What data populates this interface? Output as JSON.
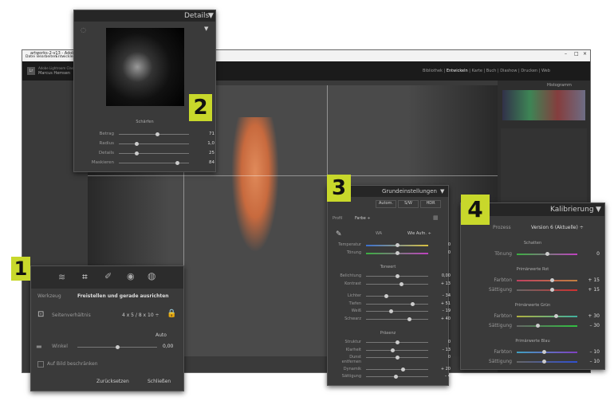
{
  "window": {
    "app_title": "artworks-2-v13 - Adobe Photoshop Lightroom Classic",
    "menus": [
      "Datei",
      "Bearbeiten",
      "Entwicklen"
    ],
    "catalog_line1": "Adobe Lightroom Classic",
    "catalog_line2": "Marcus Hemsen",
    "modules": [
      "Bibliothek",
      "Entwickeln",
      "Karte",
      "Buch",
      "Diashow",
      "Drucken",
      "Web"
    ],
    "active_module": "Entwickeln",
    "histogram_label": "Histogramm",
    "win_controls": [
      "–",
      "□",
      "×"
    ]
  },
  "badges": [
    "1",
    "2",
    "3",
    "4"
  ],
  "details": {
    "title": "Details",
    "section": "Schärfen",
    "sliders": [
      {
        "label": "Betrag",
        "value": "71",
        "pos": 0.55
      },
      {
        "label": "Radius",
        "value": "1,0",
        "pos": 0.25
      },
      {
        "label": "Details",
        "value": "25",
        "pos": 0.25
      },
      {
        "label": "Maskieren",
        "value": "84",
        "pos": 0.84
      }
    ]
  },
  "crop": {
    "tool_label": "Werkzeug",
    "tool_name": "Freistellen und gerade ausrichten",
    "aspect_label": "Seitenverhältnis",
    "aspect_value": "4 x 5 / 8 x 10 ÷",
    "auto_label": "Auto",
    "angle_label": "Winkel",
    "angle_value": "0,00",
    "angle_pos": 0.5,
    "constrain_label": "Auf Bild beschränken",
    "reset_label": "Zurücksetzen",
    "close_label": "Schließen"
  },
  "basic": {
    "title": "Grundeinstellungen",
    "modes": [
      "Autom.",
      "S/W",
      "HDR"
    ],
    "profile_label": "Profil",
    "profile_value": "Farbe ÷",
    "wb_label": "WA",
    "wb_value": "Wie Aufn. ÷",
    "wb_sliders": [
      {
        "label": "Temperatur",
        "value": "0",
        "pos": 0.5
      },
      {
        "label": "Tönung",
        "value": "0",
        "pos": 0.5
      }
    ],
    "tone_section": "Tonwert",
    "tone_sliders": [
      {
        "label": "Belichtung",
        "value": "0,00",
        "pos": 0.5
      },
      {
        "label": "Kontrast",
        "value": "+ 13",
        "pos": 0.57
      },
      {
        "label": "Lichter",
        "value": "– 34",
        "pos": 0.33
      },
      {
        "label": "Tiefen",
        "value": "+ 51",
        "pos": 0.75
      },
      {
        "label": "Weiß",
        "value": "– 19",
        "pos": 0.4
      },
      {
        "label": "Schwarz",
        "value": "+ 40",
        "pos": 0.7
      }
    ],
    "presence_section": "Präsenz",
    "presence_sliders": [
      {
        "label": "Struktur",
        "value": "0",
        "pos": 0.5
      },
      {
        "label": "Klarheit",
        "value": "– 13",
        "pos": 0.43
      },
      {
        "label": "Dunst entfernen",
        "value": "0",
        "pos": 0.5
      },
      {
        "label": "Dynamik",
        "value": "+ 20",
        "pos": 0.6
      },
      {
        "label": "Sättigung",
        "value": "– 4",
        "pos": 0.48
      }
    ]
  },
  "calib": {
    "title": "Kalibrierung",
    "process_label": "Prozess",
    "process_value": "Version 6 (Aktuelle) ÷",
    "shadows_section": "Schatten",
    "shadows_tint_label": "Tönung",
    "shadows_tint_value": "0",
    "shadows_tint_pos": 0.5,
    "red_section": "Primärwerte Rot",
    "red": [
      {
        "label": "Farbton",
        "value": "+ 15",
        "pos": 0.58
      },
      {
        "label": "Sättigung",
        "value": "+ 15",
        "pos": 0.58
      }
    ],
    "green_section": "Primärwerte Grün",
    "green": [
      {
        "label": "Farbton",
        "value": "+ 30",
        "pos": 0.65
      },
      {
        "label": "Sättigung",
        "value": "– 30",
        "pos": 0.35
      }
    ],
    "blue_section": "Primärwerte Blau",
    "blue": [
      {
        "label": "Farbton",
        "value": "– 10",
        "pos": 0.45
      },
      {
        "label": "Sättigung",
        "value": "– 10",
        "pos": 0.45
      }
    ]
  }
}
